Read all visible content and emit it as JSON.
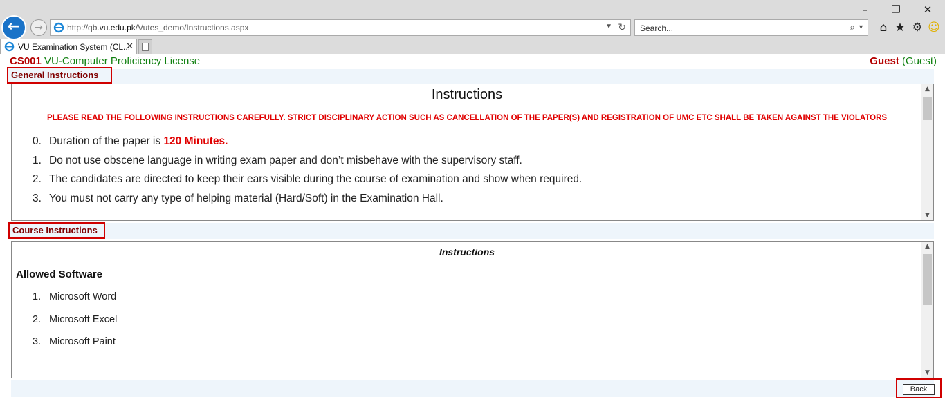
{
  "browser": {
    "address_url": "http://qb.vu.edu.pk/Vutes_demo/Instructions.aspx",
    "address_domain": "vu.edu.pk",
    "search_placeholder": "Search...",
    "tab_title": "VU Examination System (CL...",
    "icons": [
      "back-arrow-icon",
      "forward-arrow-icon",
      "ie-logo-icon",
      "refresh-icon",
      "search-icon",
      "home-icon",
      "favorites-star-icon",
      "settings-gear-icon",
      "smiley-feedback-icon",
      "new-tab-icon",
      "minimize-icon",
      "restore-icon",
      "close-icon"
    ]
  },
  "header": {
    "course_code": "CS001",
    "course_name": "VU-Computer Proficiency License",
    "user_name": "Guest",
    "user_role": "(Guest)"
  },
  "general": {
    "section_label": "General Instructions",
    "title": "Instructions",
    "warning": "PLEASE READ THE FOLLOWING INSTRUCTIONS CAREFULLY. STRICT DISCIPLINARY ACTION SUCH AS CANCELLATION OF THE PAPER(S) AND REGISTRATION OF UMC ETC SHALL BE TAKEN AGAINST THE VIOLATORS",
    "items": [
      {
        "num": "0.",
        "text": "Duration of the paper is ",
        "highlight": "120 Minutes."
      },
      {
        "num": "1.",
        "text": "Do not use obscene language in writing exam paper and don’t misbehave with the supervisory staff."
      },
      {
        "num": "2.",
        "text": "The candidates are directed to keep their ears visible during the course of examination and show when required."
      },
      {
        "num": "3.",
        "text": "You must not carry any type of helping material (Hard/Soft) in the Examination Hall."
      }
    ]
  },
  "course": {
    "section_label": "Course Instructions",
    "title": "Instructions",
    "subheading": "Allowed Software",
    "items": [
      {
        "num": "1.",
        "text": "Microsoft Word"
      },
      {
        "num": "2.",
        "text": "Microsoft Excel"
      },
      {
        "num": "3.",
        "text": "Microsoft Paint"
      }
    ]
  },
  "footer": {
    "back_label": "Back"
  },
  "colors": {
    "brand_red": "#b50000",
    "brand_green": "#108010",
    "warning_red": "#e00000",
    "highlight_border": "#d00000",
    "band_blue": "#eef5fb"
  }
}
